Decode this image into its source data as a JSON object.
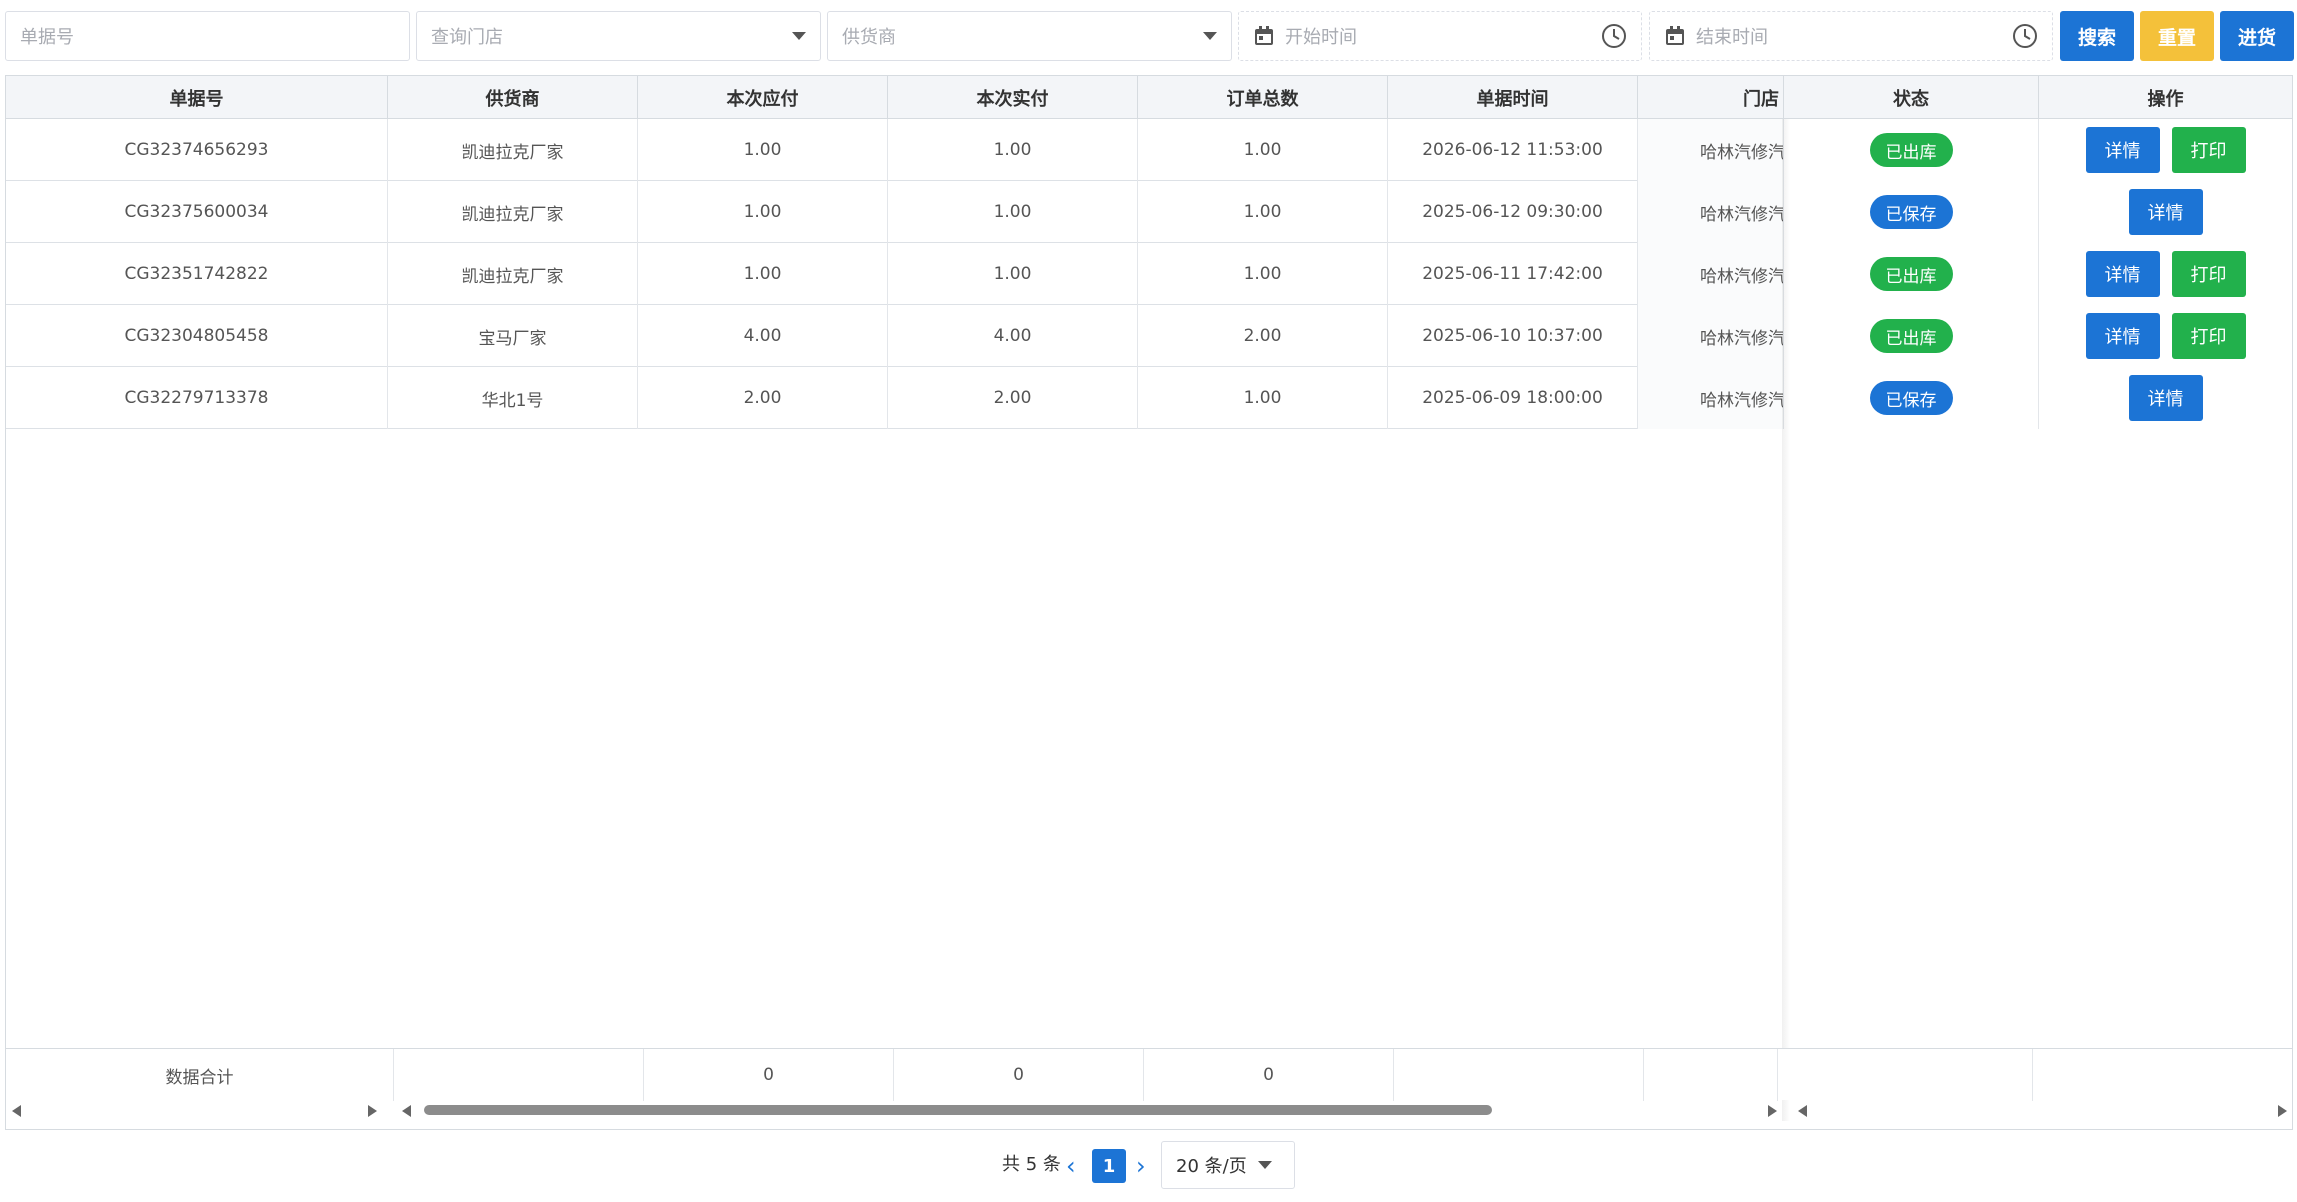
{
  "toolbar": {
    "order_no_placeholder": "单据号",
    "store_placeholder": "查询门店",
    "supplier_placeholder": "供货商",
    "start_time_placeholder": "开始时间",
    "end_time_placeholder": "结束时间",
    "search_label": "搜索",
    "reset_label": "重置",
    "purchase_label": "进货"
  },
  "colors": {
    "primary": "#1c74d5",
    "success": "#22b14c",
    "warning": "#f4c13a"
  },
  "table": {
    "columns": [
      "单据号",
      "供货商",
      "本次应付",
      "本次实付",
      "订单总数",
      "单据时间",
      "门店",
      "状态",
      "操作"
    ],
    "rows": [
      {
        "order_no": "CG32374656293",
        "supplier": "凯迪拉克厂家",
        "payable": "1.00",
        "paid": "1.00",
        "total": "1.00",
        "time": "2026-06-12 11:53:00",
        "store": "哈林汽修汽",
        "status": "已出库",
        "status_color": "green",
        "actions": [
          "详情",
          "打印"
        ]
      },
      {
        "order_no": "CG32375600034",
        "supplier": "凯迪拉克厂家",
        "payable": "1.00",
        "paid": "1.00",
        "total": "1.00",
        "time": "2025-06-12 09:30:00",
        "store": "哈林汽修汽",
        "status": "已保存",
        "status_color": "blue",
        "actions": [
          "详情"
        ]
      },
      {
        "order_no": "CG32351742822",
        "supplier": "凯迪拉克厂家",
        "payable": "1.00",
        "paid": "1.00",
        "total": "1.00",
        "time": "2025-06-11 17:42:00",
        "store": "哈林汽修汽",
        "status": "已出库",
        "status_color": "green",
        "actions": [
          "详情",
          "打印"
        ]
      },
      {
        "order_no": "CG32304805458",
        "supplier": "宝马厂家",
        "payable": "4.00",
        "paid": "4.00",
        "total": "2.00",
        "time": "2025-06-10 10:37:00",
        "store": "哈林汽修汽",
        "status": "已出库",
        "status_color": "green",
        "actions": [
          "详情",
          "打印"
        ]
      },
      {
        "order_no": "CG32279713378",
        "supplier": "华北1号",
        "payable": "2.00",
        "paid": "2.00",
        "total": "1.00",
        "time": "2025-06-09 18:00:00",
        "store": "哈林汽修汽",
        "status": "已保存",
        "status_color": "blue",
        "actions": [
          "详情"
        ]
      }
    ],
    "summary": {
      "label": "数据合计",
      "payable": "0",
      "paid": "0",
      "total": "0"
    }
  },
  "pagination": {
    "total_text": "共 5 条",
    "current_page": "1",
    "page_size": "20 条/页"
  }
}
